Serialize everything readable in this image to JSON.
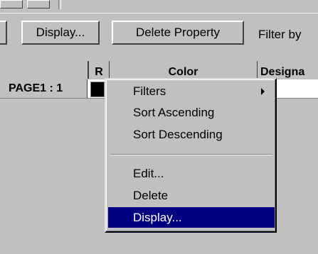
{
  "toolbar": {
    "display_button": "Display...",
    "delete_property_button": "Delete Property",
    "filter_by_label": "Filter by"
  },
  "grid": {
    "columns": [
      "R",
      "Color",
      "Designa"
    ],
    "rows": [
      {
        "header": "PAGE1 : 1",
        "swatch_color": "#000000"
      }
    ]
  },
  "context_menu": {
    "items": [
      {
        "label": "Filters",
        "submenu": true
      },
      {
        "label": "Sort Ascending"
      },
      {
        "label": "Sort Descending"
      },
      {
        "label": "Edit..."
      },
      {
        "label": "Delete"
      },
      {
        "label": "Display...",
        "selected": true
      }
    ],
    "highlight_color": "#000080"
  }
}
